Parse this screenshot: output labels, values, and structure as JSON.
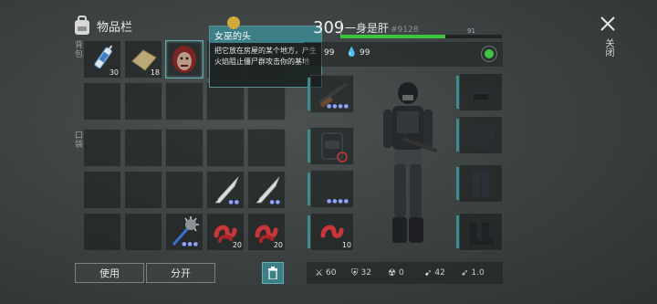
{
  "inventory": {
    "title": "物品栏",
    "side_top": "背包",
    "side_mid": "口袋",
    "slots_top": [
      {
        "name": "syringe",
        "qty": "30"
      },
      {
        "name": "cloth",
        "qty": "18"
      },
      {
        "name": "witch-head",
        "qty": ""
      }
    ],
    "weapons": [
      {
        "name": "machete",
        "qty": ""
      },
      {
        "name": "machete",
        "qty": ""
      },
      {
        "name": "morning-star-mace",
        "qty": ""
      },
      {
        "name": "red-bundle",
        "qty": "20"
      },
      {
        "name": "red-bundle",
        "qty": "20"
      }
    ],
    "buttons": {
      "use": "使用",
      "split": "分开"
    }
  },
  "tooltip": {
    "title": "女巫的头",
    "body": "把它放在房屋的某个地方，产生火焰阻止僵尸群攻击你的基地"
  },
  "character": {
    "level": "309",
    "name": "一身是肝",
    "id": "#9128",
    "progress_value": "91",
    "progress_fraction": 0.65,
    "food": "99",
    "water": "99"
  },
  "equipment": {
    "shotgun": "shotgun",
    "backpack": "backpack",
    "pistol": "pistol",
    "ammo_qty": "10"
  },
  "stats": [
    {
      "icon": "attack-icon",
      "value": "60"
    },
    {
      "icon": "defense-icon",
      "value": "32"
    },
    {
      "icon": "radiation-icon",
      "value": "0"
    },
    {
      "icon": "speed-icon",
      "value": "42"
    },
    {
      "icon": "dodge-icon",
      "value": "1.0"
    }
  ],
  "close_label": "关闭",
  "colors": {
    "accent": "#3d7f86",
    "progress": "#3ec43e",
    "dots": "#8fa3ff"
  }
}
